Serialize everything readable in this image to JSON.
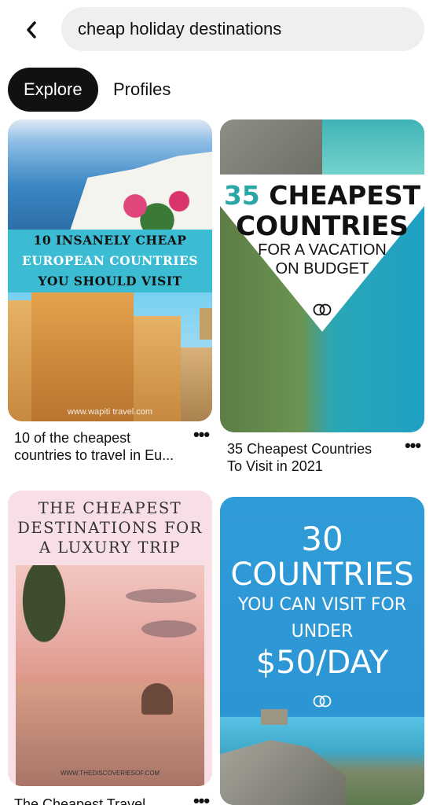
{
  "header": {
    "back_icon": "chevron-left-icon",
    "search_value": "cheap holiday destinations"
  },
  "tabs": [
    {
      "label": "Explore",
      "active": true
    },
    {
      "label": "Profiles",
      "active": false
    }
  ],
  "pins": [
    {
      "image_text": [
        "10 INSANELY CHEAP",
        "EUROPEAN COUNTRIES",
        "YOU SHOULD VISIT"
      ],
      "watermark": "www.wapiti travel.com",
      "title": "10 of the cheapest countries to travel in Eu...",
      "title_line1": "10 of the cheapest",
      "title_line2": "countries to travel in Eu...",
      "more": "•••"
    },
    {
      "image_text_num": "35",
      "image_text_1": "CHEAPEST",
      "image_text_2": "COUNTRIES",
      "image_text_3": "FOR A VACATION",
      "image_text_4": "ON BUDGET",
      "title_line1": "35 Cheapest Countries",
      "title_line2": "To Visit in 2021",
      "more": "•••"
    },
    {
      "image_text": [
        "THE CHEAPEST",
        "DESTINATIONS FOR",
        "A LUXURY TRIP"
      ],
      "watermark": "WWW.THEDISCOVERIESOF.COM",
      "title_line1": "The Cheapest Travel",
      "more": "•••"
    },
    {
      "image_text": [
        "30",
        "COUNTRIES",
        "YOU CAN VISIT FOR",
        "UNDER",
        "$50/DAY"
      ],
      "more": "•••"
    }
  ],
  "colors": {
    "search_bg": "#efefef",
    "tab_active_bg": "#111111",
    "pin1_band": "#3bbcd3",
    "pin2_accent": "#2aa7a5",
    "pin3_head": "#f7dfe5",
    "pin4_bg": "#2f9bd7"
  }
}
